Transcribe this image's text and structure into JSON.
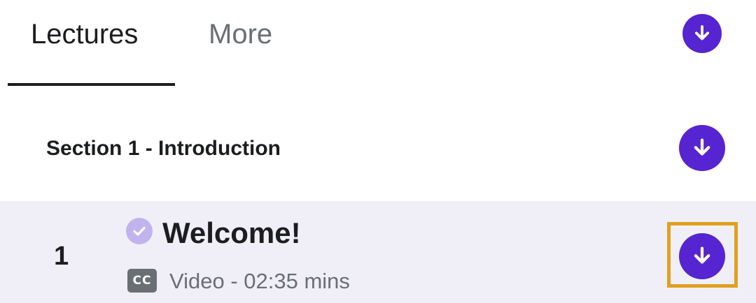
{
  "tabs": {
    "lectures_label": "Lectures",
    "more_label": "More",
    "active": "Lectures"
  },
  "section": {
    "title": "Section 1 - Introduction"
  },
  "lecture": {
    "number": "1",
    "title": "Welcome!",
    "cc_label": "CC",
    "meta": "Video - 02:35 mins",
    "completed": true
  },
  "icons": {
    "download": "download-arrow-icon",
    "check": "check-circle-icon",
    "captions": "closed-captions-icon"
  },
  "colors": {
    "accent": "#5624d0",
    "check": "#c0b3ee",
    "row_highlight": "#f0eff8",
    "focus": "#e0a020",
    "muted_text": "#6a6f73",
    "text": "#1c1d1f"
  }
}
